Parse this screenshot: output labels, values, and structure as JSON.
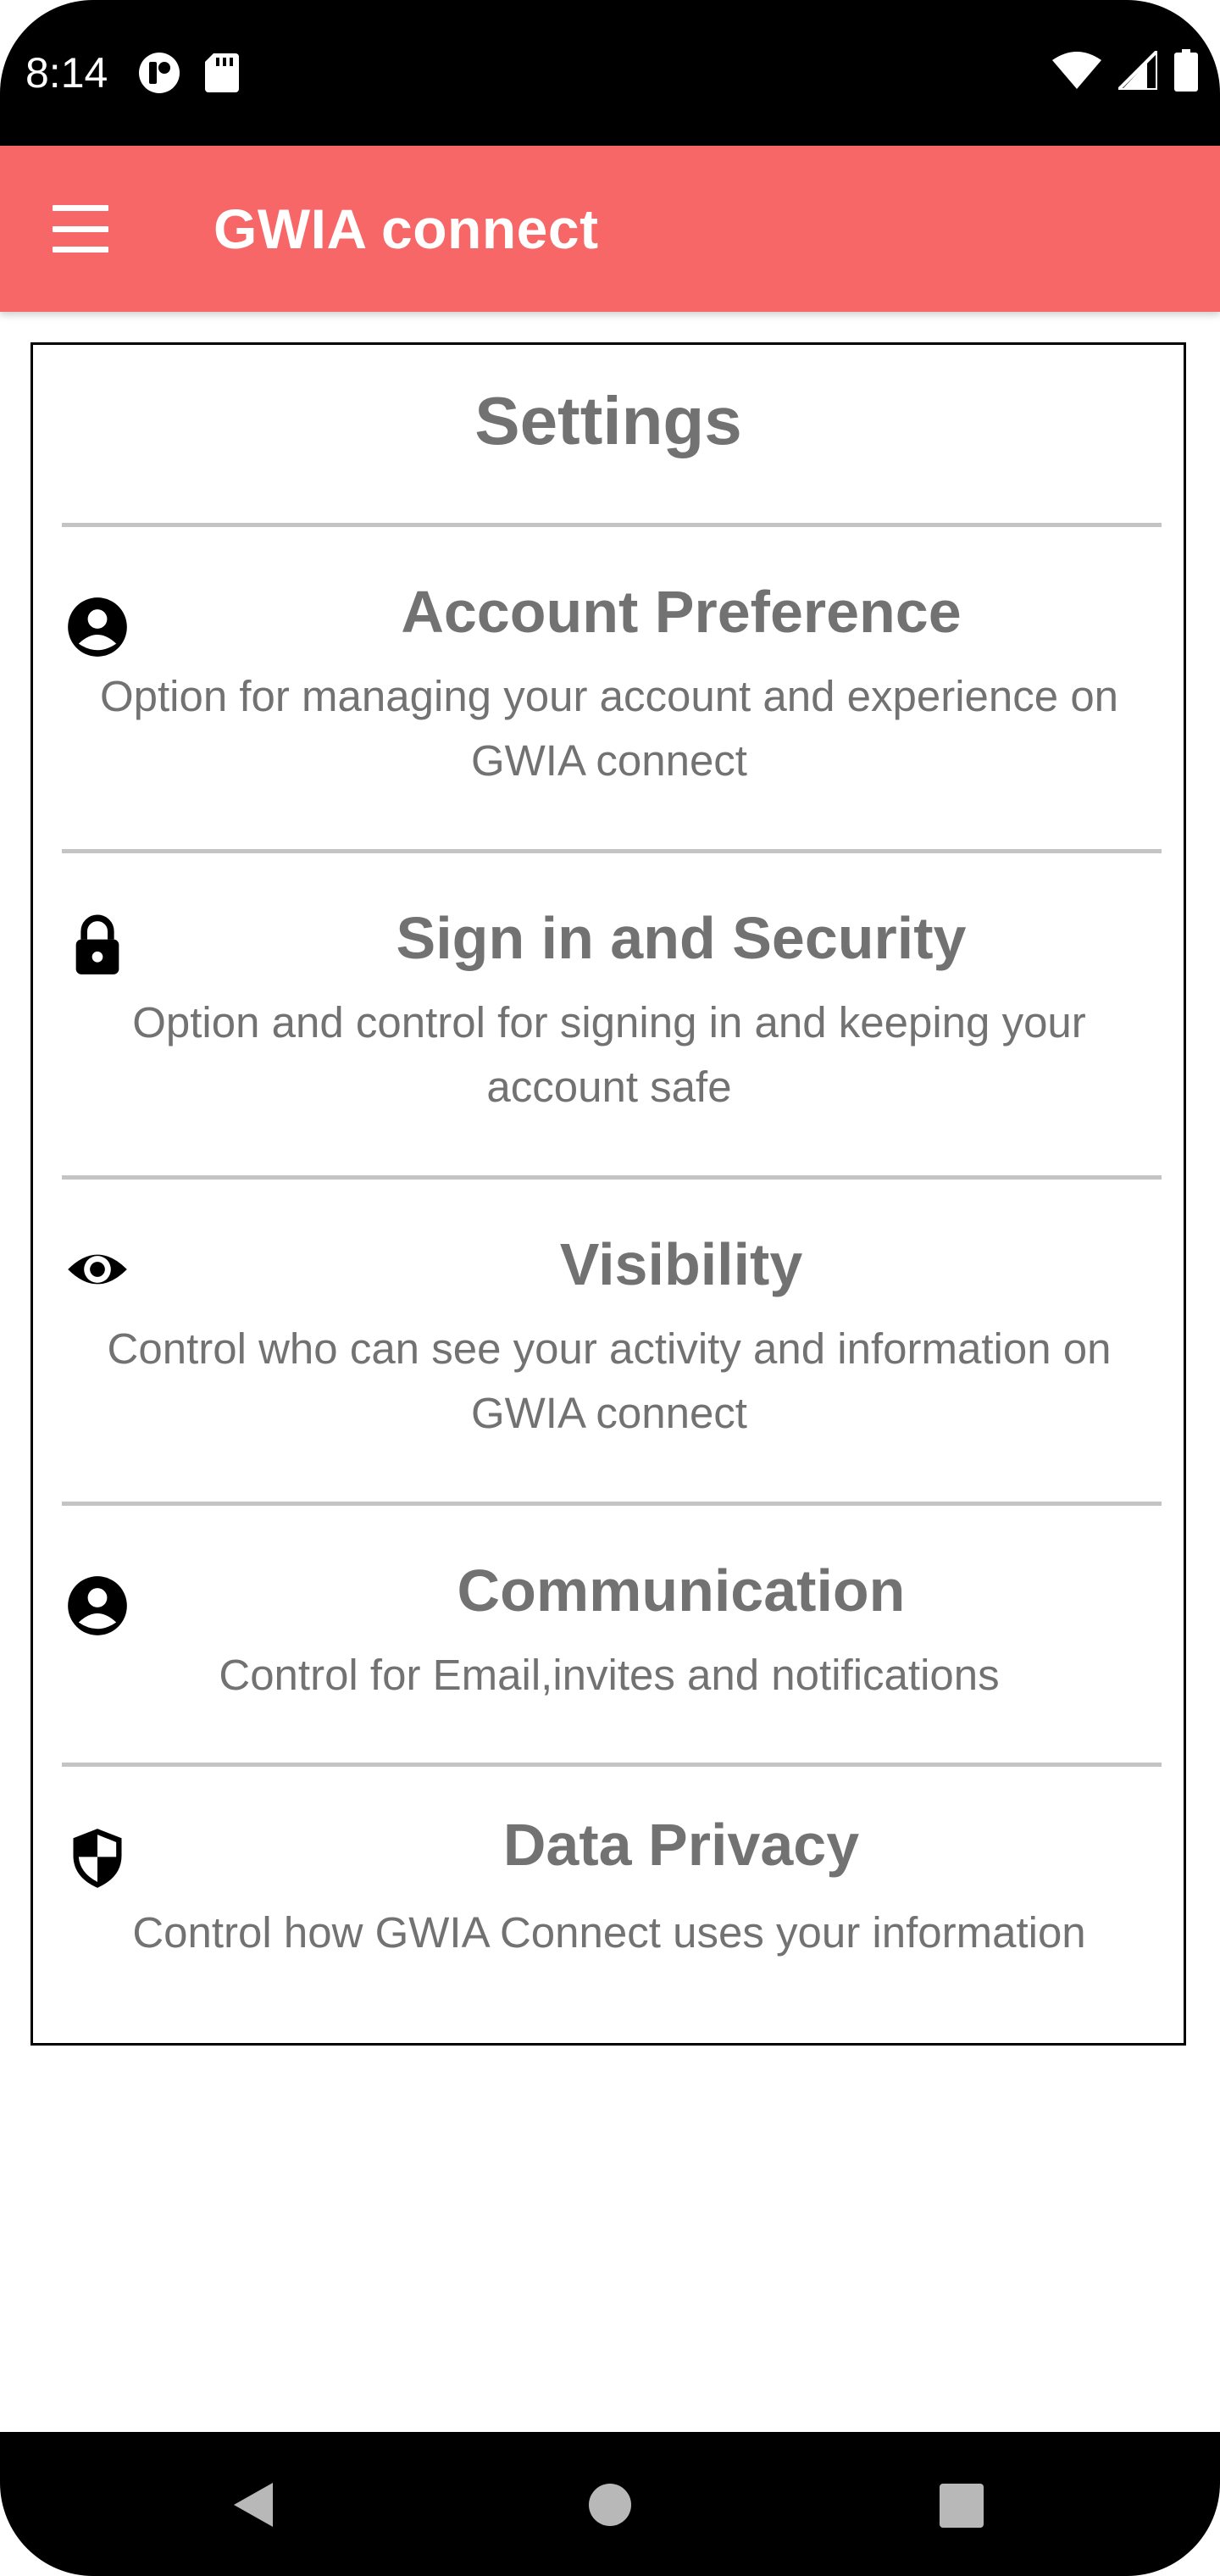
{
  "status_bar": {
    "time": "8:14",
    "left_icons": [
      "notification-badge-icon",
      "sd-card-icon"
    ],
    "right_icons": [
      "wifi-icon",
      "cell-signal-icon",
      "battery-icon"
    ]
  },
  "app_bar": {
    "title": "GWIA connect",
    "menu_icon": "hamburger-menu-icon"
  },
  "settings": {
    "title": "Settings",
    "items": [
      {
        "icon": "account-circle-icon",
        "title": "Account Preference",
        "description": "Option for managing your account and experience on GWIA connect"
      },
      {
        "icon": "lock-icon",
        "title": "Sign in and Security",
        "description": "Option and control for signing in and keeping your account safe"
      },
      {
        "icon": "eye-icon",
        "title": "Visibility",
        "description": "Control who can see your activity and information on GWIA connect"
      },
      {
        "icon": "account-circle-icon",
        "title": "Communication",
        "description": "Control for Email,invites and notifications"
      },
      {
        "icon": "shield-icon",
        "title": "Data Privacy",
        "description": "Control how GWIA Connect uses your information"
      }
    ]
  },
  "nav_bar": {
    "buttons": [
      "back-triangle-icon",
      "home-circle-icon",
      "recents-square-icon"
    ]
  },
  "colors": {
    "app_bar": "#f76767",
    "text_gray": "#727272",
    "divider": "#c4c4c4"
  }
}
